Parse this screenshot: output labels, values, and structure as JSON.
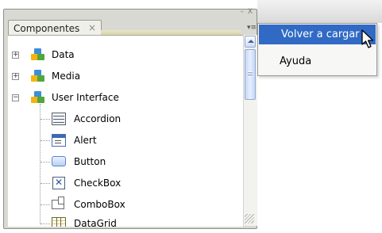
{
  "panel": {
    "tab_label": "Componentes",
    "tab_close": "×",
    "window_controls": "–  X"
  },
  "tree": [
    {
      "label": "Data",
      "expander": "+"
    },
    {
      "label": "Media",
      "expander": "+"
    },
    {
      "label": "User Interface",
      "expander": "−"
    }
  ],
  "components": [
    {
      "label": "Accordion",
      "icon": "accordion-icon"
    },
    {
      "label": "Alert",
      "icon": "alert-icon"
    },
    {
      "label": "Button",
      "icon": "button-icon"
    },
    {
      "label": "CheckBox",
      "icon": "checkbox-icon"
    },
    {
      "label": "ComboBox",
      "icon": "combobox-icon"
    },
    {
      "label": "DataGrid",
      "icon": "datagrid-icon"
    }
  ],
  "context_menu": {
    "items": [
      "Volver a cargar",
      "Ayuda"
    ],
    "highlight_color": "#316ac5"
  }
}
